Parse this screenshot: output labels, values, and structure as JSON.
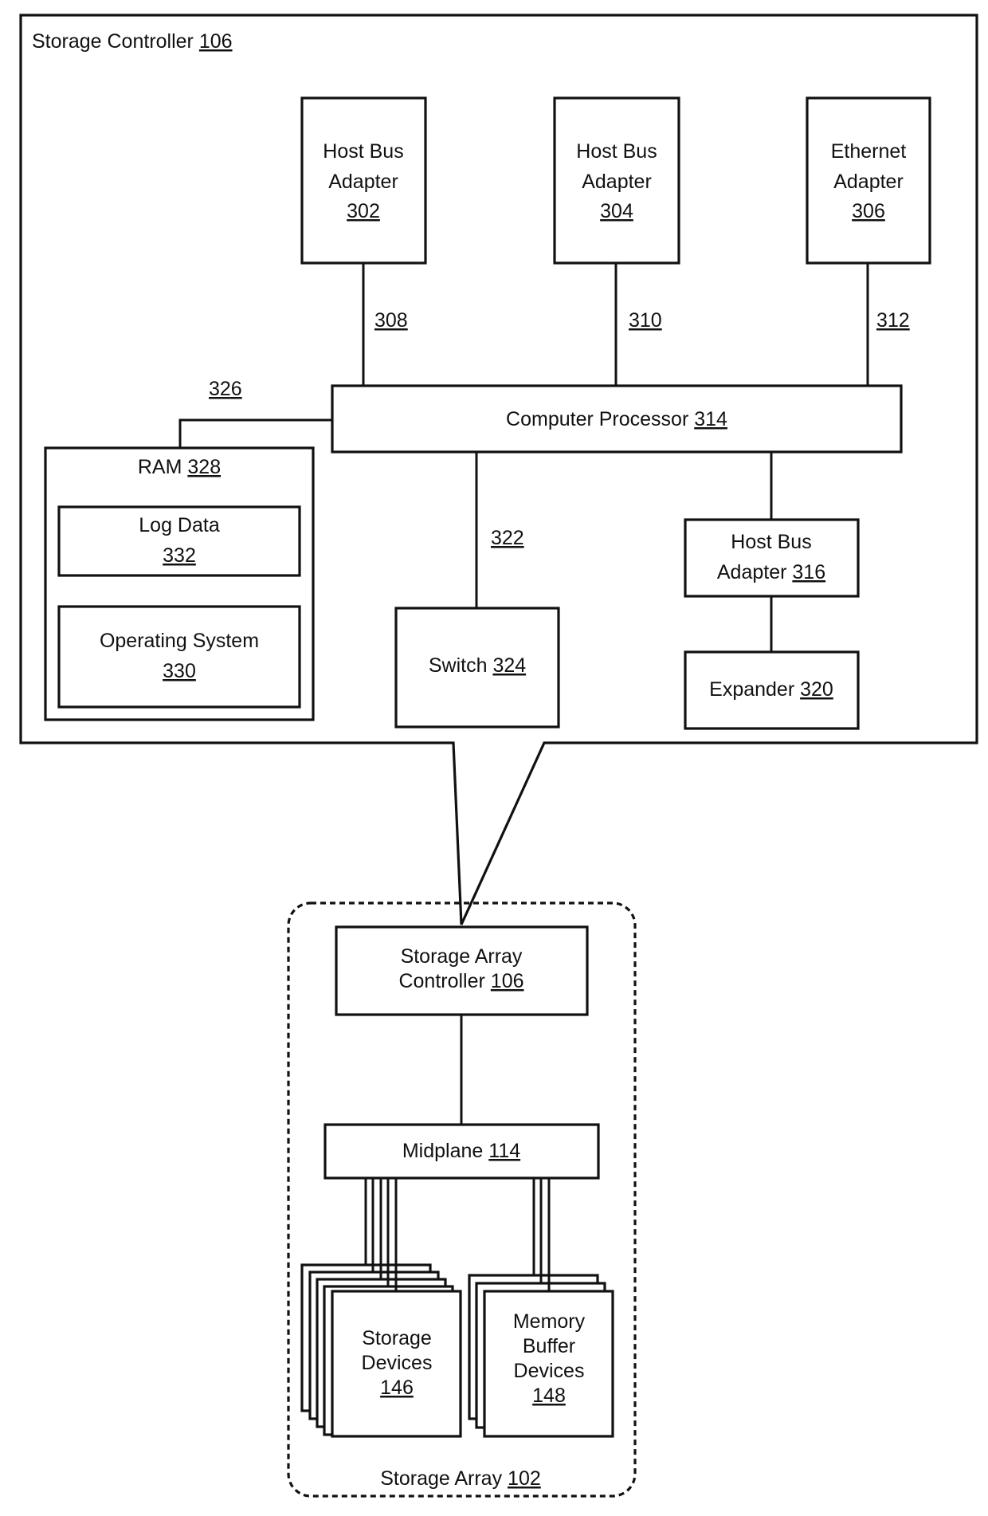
{
  "controller": {
    "title": "Storage Controller",
    "title_ref": "106",
    "hba_302": {
      "line1": "Host Bus",
      "line2": "Adapter",
      "ref": "302"
    },
    "hba_304": {
      "line1": "Host Bus",
      "line2": "Adapter",
      "ref": "304"
    },
    "ethernet_306": {
      "line1": "Ethernet",
      "line2": "Adapter",
      "ref": "306"
    },
    "link_308": "308",
    "link_310": "310",
    "link_312": "312",
    "processor": {
      "label": "Computer Processor",
      "ref": "314"
    },
    "link_326": "326",
    "ram": {
      "label": "RAM",
      "ref": "328"
    },
    "log_data": {
      "label": "Log Data",
      "ref": "332"
    },
    "os": {
      "label": "Operating System",
      "ref": "330"
    },
    "link_322": "322",
    "switch": {
      "label": "Switch",
      "ref": "324"
    },
    "hba_316": {
      "line1": "Host Bus",
      "line2": "Adapter",
      "ref": "316"
    },
    "expander": {
      "label": "Expander",
      "ref": "320"
    }
  },
  "array": {
    "title": "Storage Array",
    "title_ref": "102",
    "controller": {
      "line1": "Storage Array",
      "line2": "Controller",
      "ref": "106"
    },
    "midplane": {
      "label": "Midplane",
      "ref": "114"
    },
    "storage_devices": {
      "line1": "Storage",
      "line2": "Devices",
      "ref": "146"
    },
    "memory_buffer": {
      "line1": "Memory",
      "line2": "Buffer",
      "line3": "Devices",
      "ref": "148"
    }
  }
}
